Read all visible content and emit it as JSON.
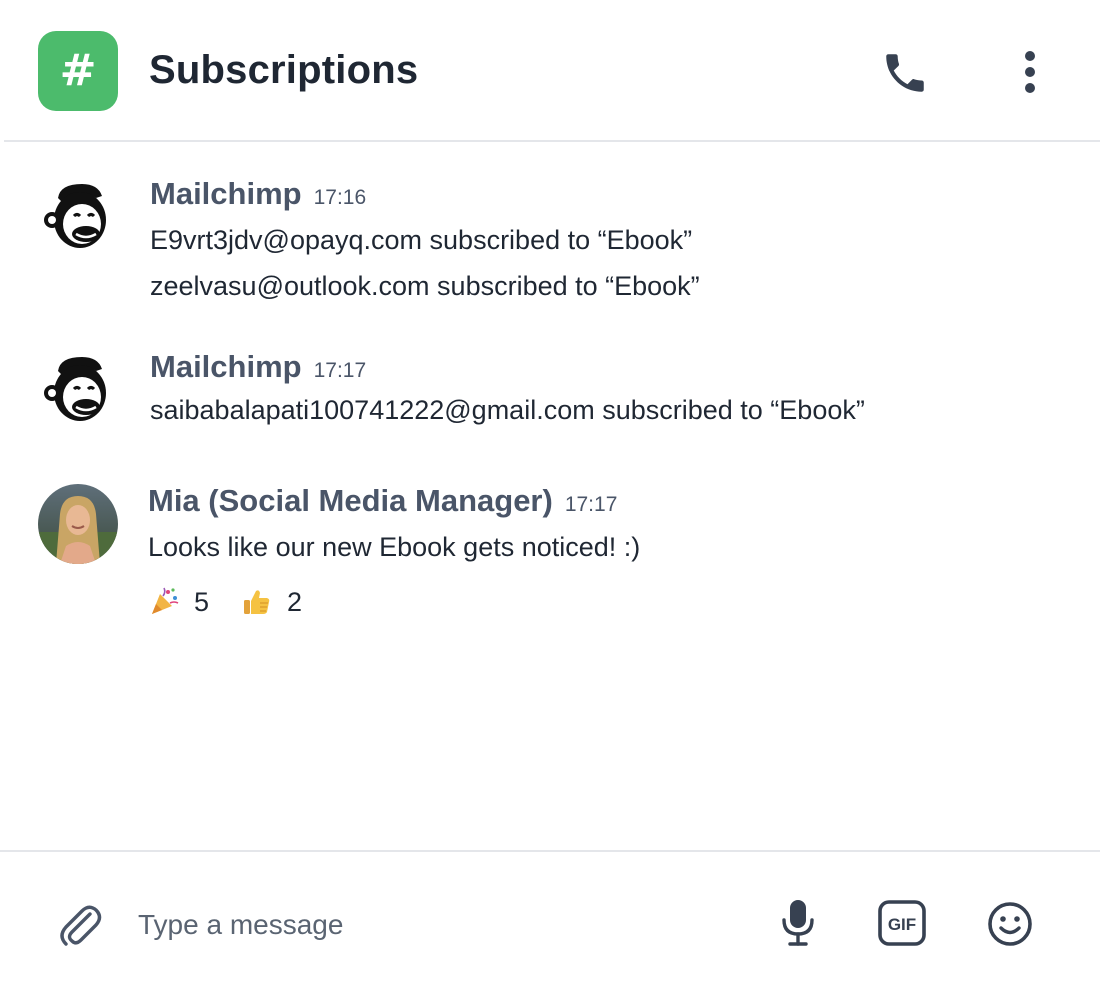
{
  "header": {
    "channel_icon": "hash-icon",
    "channel_symbol": "#",
    "title": "Subscriptions",
    "phone_icon": "phone-icon",
    "more_icon": "more-vertical-icon",
    "accent_color": "#4cbb6c"
  },
  "messages": [
    {
      "avatar": "mailchimp-logo",
      "author": "Mailchimp",
      "time": "17:16",
      "lines": [
        "E9vrt3jdv@opayq.com subscribed to “Ebook”",
        "zeelvasu@outlook.com subscribed to “Ebook”"
      ]
    },
    {
      "avatar": "mailchimp-logo",
      "author": "Mailchimp",
      "time": "17:17",
      "lines": [
        "saibabalapati100741222@gmail.com subscribed to “Ebook”"
      ]
    },
    {
      "avatar": "user-photo",
      "author": "Mia (Social Media Manager)",
      "time": "17:17",
      "lines": [
        "Looks like our new Ebook gets noticed! :)"
      ],
      "reactions": [
        {
          "icon": "party-popper-icon",
          "count": "5"
        },
        {
          "icon": "thumbs-up-icon",
          "count": "2"
        }
      ]
    }
  ],
  "composer": {
    "placeholder": "Type a message",
    "attach_icon": "paperclip-icon",
    "mic_icon": "microphone-icon",
    "gif_icon": "gif-icon",
    "emoji_icon": "smiley-icon"
  }
}
